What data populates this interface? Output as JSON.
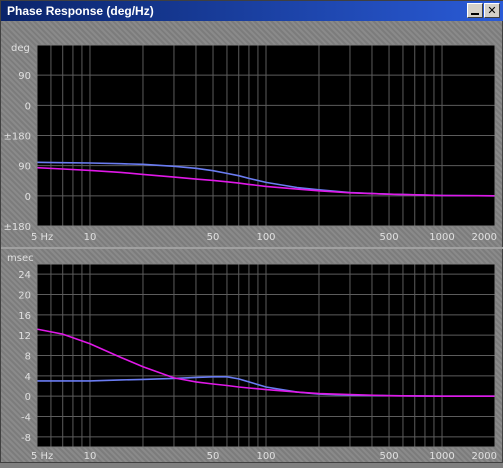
{
  "window": {
    "title": "Phase Response (deg/Hz)",
    "minimize_glyph": "_",
    "close_glyph": "✕"
  },
  "colors": {
    "plot_bg": "#000000",
    "grid": "#5c5c5c",
    "series_blue": "#6a7cf2",
    "series_magenta": "#e018e8",
    "frame": "#808080"
  },
  "chart_data": [
    {
      "type": "line",
      "xscale": "log",
      "xlim": [
        5,
        2000
      ],
      "ylabel": "deg",
      "y_tick_labels": [
        "90",
        "0",
        "±180",
        "90",
        "0",
        "±180"
      ],
      "x_tick_labels": [
        "5 Hz",
        "10",
        "50",
        "100",
        "500",
        "1000",
        "2000"
      ],
      "x_ticks": [
        5,
        10,
        50,
        100,
        500,
        1000,
        2000
      ],
      "grid": true,
      "series": [
        {
          "color": "blue",
          "x": [
            5,
            7,
            10,
            15,
            20,
            30,
            40,
            50,
            60,
            70,
            80,
            100,
            150,
            200,
            300,
            500,
            700,
            1000,
            2000
          ],
          "y": [
            100,
            99,
            98,
            96,
            94,
            88,
            82,
            75,
            67,
            60,
            52,
            40,
            25,
            18,
            10,
            5,
            3,
            1,
            0
          ]
        },
        {
          "color": "magenta",
          "x": [
            5,
            7,
            10,
            15,
            20,
            30,
            40,
            50,
            60,
            70,
            80,
            100,
            150,
            200,
            300,
            500,
            700,
            1000,
            2000
          ],
          "y": [
            84,
            80,
            76,
            70,
            64,
            56,
            50,
            46,
            42,
            38,
            34,
            28,
            20,
            15,
            9,
            5,
            3,
            1,
            0
          ]
        }
      ]
    },
    {
      "type": "line",
      "xscale": "log",
      "xlim": [
        5,
        2000
      ],
      "ylim": [
        -10,
        26
      ],
      "ylabel": "msec",
      "y_ticks": [
        24,
        20,
        16,
        12,
        8,
        4,
        0,
        -4,
        -8
      ],
      "y_tick_labels": [
        "24",
        "20",
        "16",
        "12",
        "8",
        "4",
        "0",
        "-4",
        "-8"
      ],
      "x_tick_labels": [
        "5 Hz",
        "10",
        "50",
        "100",
        "500",
        "1000",
        "2000"
      ],
      "x_ticks": [
        5,
        10,
        50,
        100,
        500,
        1000,
        2000
      ],
      "grid": true,
      "series": [
        {
          "color": "blue",
          "x": [
            5,
            7,
            10,
            15,
            20,
            30,
            40,
            50,
            60,
            70,
            80,
            100,
            150,
            200,
            300,
            500,
            1000,
            2000
          ],
          "y": [
            3,
            3,
            3,
            3.2,
            3.3,
            3.5,
            3.7,
            3.8,
            3.8,
            3.4,
            2.8,
            1.8,
            0.8,
            0.4,
            0.2,
            0.1,
            0,
            0
          ]
        },
        {
          "color": "magenta",
          "x": [
            5,
            7,
            10,
            15,
            20,
            30,
            40,
            50,
            60,
            70,
            80,
            100,
            150,
            200,
            300,
            500,
            1000,
            2000
          ],
          "y": [
            13.2,
            12.2,
            10.3,
            7.6,
            5.8,
            3.6,
            2.8,
            2.4,
            2.1,
            1.8,
            1.6,
            1.3,
            0.8,
            0.5,
            0.3,
            0.1,
            0,
            0
          ]
        }
      ]
    }
  ]
}
